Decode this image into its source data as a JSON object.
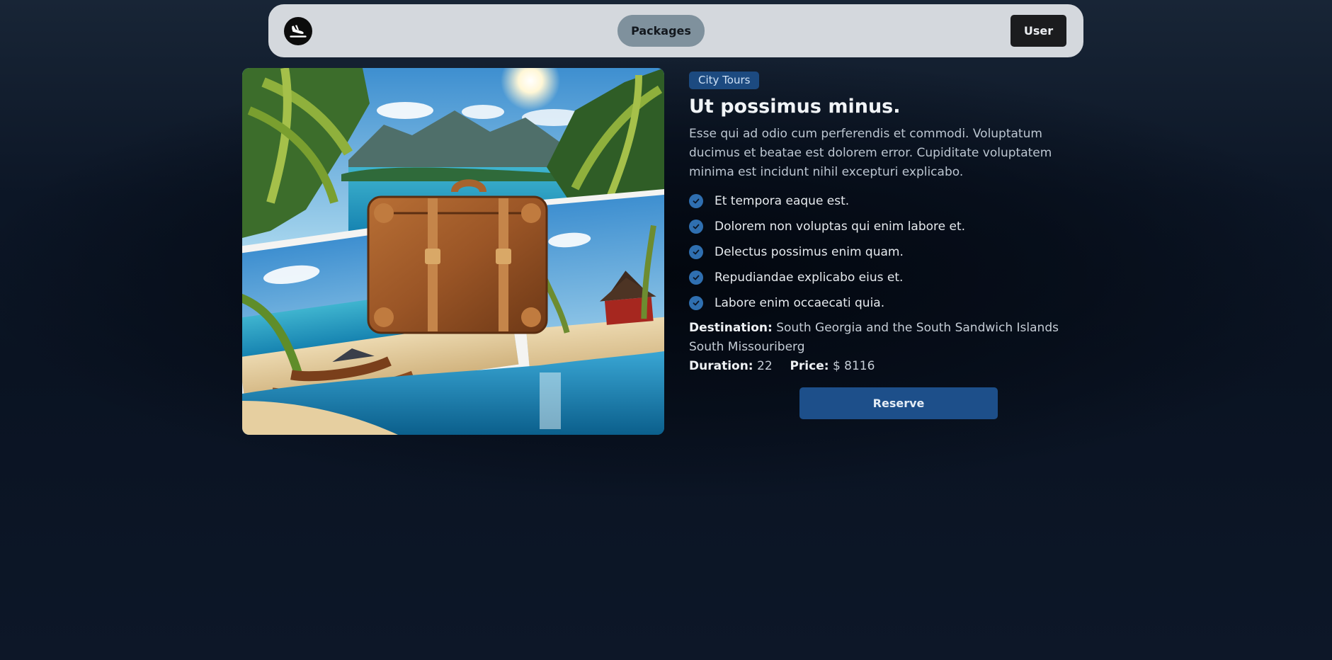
{
  "nav": {
    "logo_icon": "plane-landing-icon",
    "packages_label": "Packages",
    "user_label": "User"
  },
  "hero": {
    "image_description": "travel-collage-suitcase-beach"
  },
  "package": {
    "category": "City Tours",
    "title": "Ut possimus minus.",
    "description": "Esse qui ad odio cum perferendis et commodi. Voluptatum ducimus et beatae est dolorem error. Cupiditate voluptatem minima est incidunt nihil excepturi explicabo.",
    "features": [
      "Et tempora eaque est.",
      "Dolorem non voluptas qui enim labore et.",
      "Delectus possimus enim quam.",
      "Repudiandae explicabo eius et.",
      "Labore enim occaecati quia."
    ],
    "destination_label": "Destination:",
    "destination_value": "South Georgia and the South Sandwich Islands South Missouriberg",
    "duration_label": "Duration:",
    "duration_value": "22",
    "price_label": "Price:",
    "price_value": "$ 8116",
    "reserve_label": "Reserve"
  },
  "colors": {
    "accent": "#1d4f8a",
    "badge": "#1c4a80",
    "check": "#2f6fb0",
    "navbar": "#d4d8dd"
  }
}
